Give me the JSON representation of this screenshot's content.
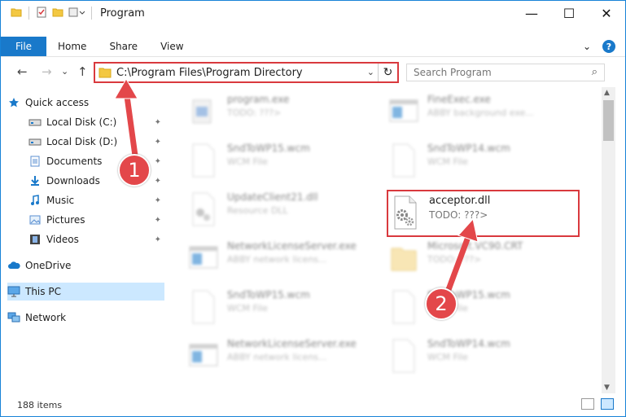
{
  "window": {
    "title": "Program",
    "minimize": "—",
    "maximize": "☐",
    "close": "✕"
  },
  "ribbon": {
    "file": "File",
    "tabs": [
      "Home",
      "Share",
      "View"
    ],
    "expand": "⌄",
    "help": "?"
  },
  "address": {
    "path": "C:\\Program Files\\Program Directory",
    "dropdown": "⌄",
    "refresh": "↻"
  },
  "search": {
    "placeholder": "Search Program",
    "icon": "⌕"
  },
  "nav_buttons": {
    "back": "←",
    "forward": "→",
    "recent": "⌄",
    "up": "↑"
  },
  "sidebar": {
    "items": [
      {
        "label": "Quick access",
        "icon": "star-icon"
      },
      {
        "label": "Local Disk (C:)",
        "icon": "drive-icon",
        "pinned": true
      },
      {
        "label": "Local Disk (D:)",
        "icon": "drive-icon",
        "pinned": true
      },
      {
        "label": "Documents",
        "icon": "documents-icon",
        "pinned": true
      },
      {
        "label": "Downloads",
        "icon": "download-icon",
        "pinned": true
      },
      {
        "label": "Music",
        "icon": "music-icon",
        "pinned": true
      },
      {
        "label": "Pictures",
        "icon": "pictures-icon",
        "pinned": true
      },
      {
        "label": "Videos",
        "icon": "videos-icon",
        "pinned": true
      },
      {
        "label": "OneDrive",
        "icon": "cloud-icon"
      },
      {
        "label": "This PC",
        "icon": "computer-icon",
        "selected": true
      },
      {
        "label": "Network",
        "icon": "network-icon"
      }
    ],
    "pin_glyph": "📌"
  },
  "files": [
    {
      "name": "program.exe",
      "desc": "TODO: ???>",
      "icon": "exe-icon"
    },
    {
      "name": "FineExec.exe",
      "desc": "ABBY background exe...",
      "icon": "window-icon"
    },
    {
      "name": "SndToWP15.wcm",
      "desc": "WCM File",
      "icon": "file-icon"
    },
    {
      "name": "SndToWP14.wcm",
      "desc": "WCM File",
      "icon": "file-icon"
    },
    {
      "name": "UpdateClient21.dll",
      "desc": "Resource DLL",
      "icon": "dll-icon"
    },
    {
      "name": "acceptor.dll",
      "desc": "TODO: ???>",
      "icon": "dll-icon"
    },
    {
      "name": "NetworkLicenseServer.exe",
      "desc": "ABBY network licens...",
      "icon": "window-icon"
    },
    {
      "name": "Microsoft.VC90.CRT",
      "desc": "TODO: ???>",
      "icon": "folder-icon"
    },
    {
      "name": "SndToWP15.wcm",
      "desc": "WCM File",
      "icon": "file-icon"
    },
    {
      "name": "SndToWP15.wcm",
      "desc": "WCM File",
      "icon": "file-icon"
    },
    {
      "name": "NetworkLicenseServer.exe",
      "desc": "ABBY network licens...",
      "icon": "window-icon"
    },
    {
      "name": "SndToWP14.wcm",
      "desc": "WCM File",
      "icon": "file-icon"
    }
  ],
  "status": {
    "count": "188 items"
  },
  "callouts": {
    "one": "1",
    "two": "2"
  },
  "colors": {
    "accent": "#1979ca",
    "highlight": "#d9393e",
    "selected": "#cce8ff"
  }
}
